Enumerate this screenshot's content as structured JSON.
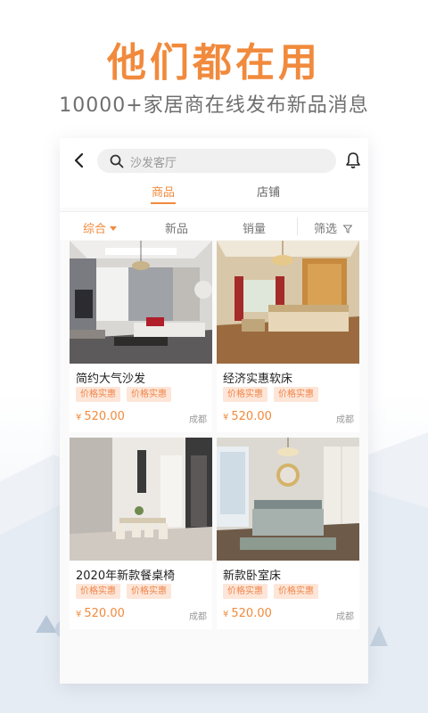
{
  "hero": {
    "title": "他们都在用",
    "subtitle": "10000+家居商在线发布新品消息"
  },
  "topbar": {
    "search_placeholder": "沙发客厅"
  },
  "tabs": [
    {
      "label": "商品",
      "active": true
    },
    {
      "label": "店铺",
      "active": false
    }
  ],
  "filters": [
    {
      "label": "综合",
      "active": true
    },
    {
      "label": "新品",
      "active": false
    },
    {
      "label": "销量",
      "active": false
    },
    {
      "label": "筛选",
      "active": false
    }
  ],
  "products": [
    {
      "title": "简约大气沙发",
      "tags": [
        "价格实惠",
        "价格实惠"
      ],
      "currency": "¥",
      "price": "520.00",
      "city": "成都"
    },
    {
      "title": "经济实惠软床",
      "tags": [
        "价格实惠",
        "价格实惠"
      ],
      "currency": "¥",
      "price": "520.00",
      "city": "成都"
    },
    {
      "title": "2020年新款餐桌椅",
      "tags": [
        "价格实惠",
        "价格实惠"
      ],
      "currency": "¥",
      "price": "520.00",
      "city": "成都"
    },
    {
      "title": "新款卧室床",
      "tags": [
        "价格实惠",
        "价格实惠"
      ],
      "currency": "¥",
      "price": "520.00",
      "city": "成都"
    }
  ],
  "colors": {
    "accent": "#f18a3c",
    "tag_bg": "#fde6d8"
  }
}
